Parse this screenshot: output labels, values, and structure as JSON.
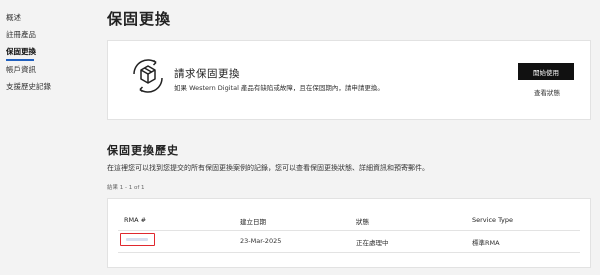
{
  "sidebar": {
    "items": [
      {
        "label": "概述"
      },
      {
        "label": "註冊產品"
      },
      {
        "label": "保固更換"
      },
      {
        "label": "帳戶資訊"
      },
      {
        "label": "支援歷史記錄"
      }
    ],
    "active_index": 2
  },
  "page": {
    "title": "保固更換"
  },
  "warranty_card": {
    "heading": "請求保固更換",
    "description": "如果 Western Digital 產品有缺陷或故障，且在保固期內，請申請更換。",
    "primary_button": "開始使用",
    "status_link": "查看狀態",
    "icon": "box-exchange-icon"
  },
  "history": {
    "title": "保固更換歷史",
    "description": "在這裡您可以找到您提交的所有保固更換案例的記錄，您可以查看保固更換狀態、詳細資訊和預寄郵件。",
    "results_count": "結果 1 - 1 of 1",
    "columns": [
      "RMA #",
      "建立日期",
      "狀態",
      "Service Type"
    ],
    "rows": [
      {
        "rma": "",
        "created": "23-Mar-2025",
        "status": "正在處理中",
        "service_type": "標準RMA"
      }
    ]
  },
  "colors": {
    "accent": "#1f5fbf",
    "highlight_border": "#e0282e",
    "button_bg": "#111111"
  }
}
